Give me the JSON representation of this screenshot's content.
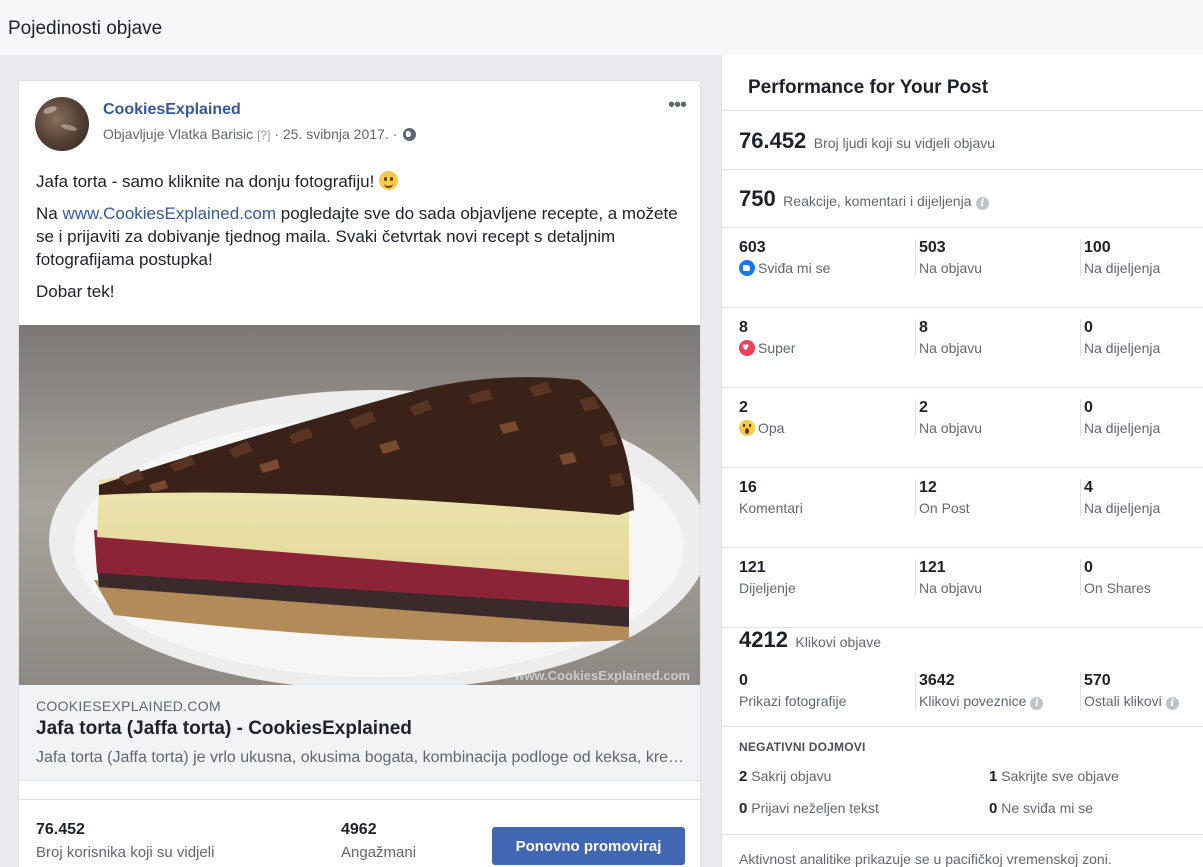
{
  "header": {
    "title": "Pojedinosti objave"
  },
  "post": {
    "page_name": "CookiesExplained",
    "author_prefix": "Objavljuje Vlatka Barisic",
    "author_help": "[?]",
    "date": "· 25. svibnja 2017. ·",
    "more": "•••",
    "text_line1": "Jafa torta - samo kliknite na donju fotografiju!",
    "text_p2_prefix": "Na",
    "text_p2_link": "www.CookiesExplained.com",
    "text_p2_rest": "pogledajte sve do sada objavljene recepte, a možete se i prijaviti za dobivanje tjednog maila. Svaki četvrtak novi recept s detaljnim fotografijama postupka!",
    "text_p3": "Dobar tek!",
    "image_watermark": "www.CookiesExplained.com",
    "link": {
      "domain": "COOKIESEXPLAINED.COM",
      "title": "Jafa torta (Jaffa torta) - CookiesExplained",
      "description": "Jafa torta (Jaffa torta) je vrlo ukusna, okusima bogata, kombinacija podloge od keksa, kreme od vanilije i džema od naranče..."
    },
    "footer": {
      "reach_value": "76.452",
      "reach_label": "Broj korisnika koji su vidjeli",
      "engagement_value": "4962",
      "engagement_label": "Angažmani",
      "boost_label": "Ponovno promoviraj"
    }
  },
  "performance": {
    "title": "Performance for Your Post",
    "reach_value": "76.452",
    "reach_label": "Broj ljudi koji su vidjeli objavu",
    "engagement_value": "750",
    "engagement_label": "Reakcije, komentari i dijeljenja",
    "rows": [
      {
        "total": "603",
        "label": "Sviđa mi se",
        "icon": "like-icon",
        "on_post": "503",
        "on_post_label": "Na objavu",
        "on_shares": "100",
        "on_shares_label": "Na dijeljenja"
      },
      {
        "total": "8",
        "label": "Super",
        "icon": "love-icon",
        "on_post": "8",
        "on_post_label": "Na objavu",
        "on_shares": "0",
        "on_shares_label": "Na dijeljenja"
      },
      {
        "total": "2",
        "label": "Opa",
        "icon": "wow-icon",
        "on_post": "2",
        "on_post_label": "Na objavu",
        "on_shares": "0",
        "on_shares_label": "Na dijeljenja"
      },
      {
        "total": "16",
        "label": "Komentari",
        "icon": "",
        "on_post": "12",
        "on_post_label": "On Post",
        "on_shares": "4",
        "on_shares_label": "Na dijeljenja"
      },
      {
        "total": "121",
        "label": "Dijeljenje",
        "icon": "",
        "on_post": "121",
        "on_post_label": "Na objavu",
        "on_shares": "0",
        "on_shares_label": "On Shares"
      }
    ],
    "clicks_value": "4212",
    "clicks_label": "Klikovi objave",
    "clicks": [
      {
        "value": "0",
        "label": "Prikazi fotografije"
      },
      {
        "value": "3642",
        "label": "Klikovi poveznice"
      },
      {
        "value": "570",
        "label": "Ostali klikovi"
      }
    ],
    "negative": {
      "title": "NEGATIVNI DOJMOVI",
      "hide_post_value": "2",
      "hide_post_label": "Sakrij objavu",
      "hide_all_value": "1",
      "hide_all_label": "Sakrijte sve objave",
      "spam_value": "0",
      "spam_label": "Prijavi neželjen tekst",
      "unlike_value": "0",
      "unlike_label": "Ne sviđa mi se"
    },
    "footnote": "Aktivnost analitike prikazuje se u pacifičkoj vremenskoj zoni."
  }
}
